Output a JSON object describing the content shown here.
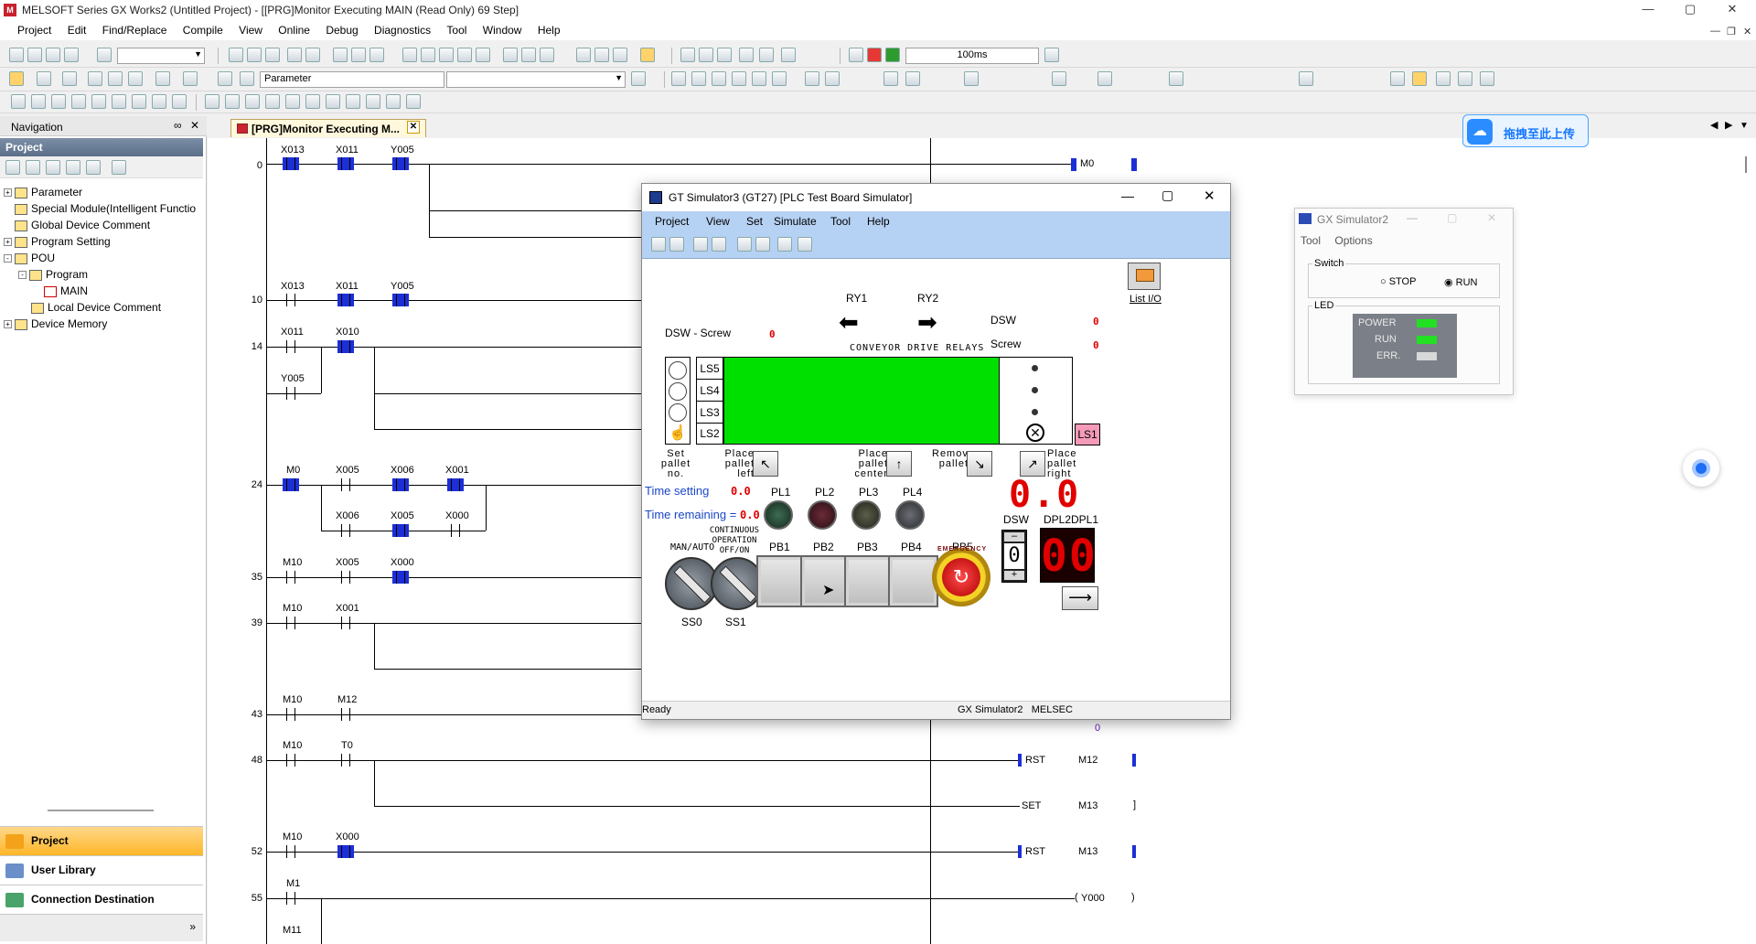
{
  "window": {
    "title": "MELSOFT Series GX Works2 (Untitled Project) - [[PRG]Monitor Executing MAIN (Read Only) 69 Step]",
    "icon_text": "M"
  },
  "menu": [
    "Project",
    "Edit",
    "Find/Replace",
    "Compile",
    "View",
    "Online",
    "Debug",
    "Diagnostics",
    "Tool",
    "Window",
    "Help"
  ],
  "toolbar": {
    "scan_combo": "100ms",
    "parameter_combo": "Parameter"
  },
  "navigation": {
    "title": "Navigation",
    "project_header": "Project",
    "tree": [
      {
        "label": "Parameter",
        "level": 0,
        "exp": "+"
      },
      {
        "label": "Special Module(Intelligent Functio",
        "level": 0,
        "exp": ""
      },
      {
        "label": "Global Device Comment",
        "level": 0,
        "exp": ""
      },
      {
        "label": "Program Setting",
        "level": 0,
        "exp": "+"
      },
      {
        "label": "POU",
        "level": 0,
        "exp": "-"
      },
      {
        "label": "Program",
        "level": 1,
        "exp": "-"
      },
      {
        "label": "MAIN",
        "level": 2,
        "exp": ""
      },
      {
        "label": "Local Device Comment",
        "level": 1,
        "exp": ""
      },
      {
        "label": "Device Memory",
        "level": 0,
        "exp": "+"
      }
    ],
    "bottom_buttons": [
      "Project",
      "User Library",
      "Connection Destination"
    ]
  },
  "editor_tab": {
    "label": "[PRG]Monitor Executing M..."
  },
  "ladder": {
    "steps": [
      "0",
      "10",
      "14",
      "24",
      "35",
      "39",
      "43",
      "48",
      "52",
      "55"
    ],
    "devices": {
      "r0": [
        "X013",
        "X011",
        "Y005"
      ],
      "r10": [
        "X013",
        "X011",
        "Y005"
      ],
      "r14": [
        "X011",
        "X010",
        "Y005"
      ],
      "r24": [
        "M0",
        "X005",
        "X006",
        "X001",
        "X006",
        "X005",
        "X000"
      ],
      "r35": [
        "M10",
        "X005",
        "X000"
      ],
      "r39": [
        "M10",
        "X001"
      ],
      "r43": [
        "M10",
        "M12"
      ],
      "r48": [
        "M10",
        "T0"
      ],
      "r52": [
        "M10",
        "X000"
      ],
      "r55": [
        "M1"
      ],
      "r_last": "M11"
    },
    "coils": {
      "m0": "M0",
      "rst1_cmd": "RST",
      "rst1_dev": "M12",
      "set_cmd": "SET",
      "set_dev": "M13",
      "rst2_cmd": "RST",
      "rst2_dev": "M13",
      "y000": "Y000",
      "timer_value": "0"
    }
  },
  "gt_simulator": {
    "title": "GT Simulator3 (GT27)  [PLC Test Board Simulator]",
    "menu": [
      "Project",
      "View",
      "Set",
      "Simulate",
      "Tool",
      "Help"
    ],
    "ry1": "RY1",
    "ry2": "RY2",
    "conveyor_label": "CONVEYOR DRIVE RELAYS",
    "list_io": "List I/O",
    "dsw_screw_label": "DSW - Screw",
    "dsw_screw_value": "0",
    "dsw_label": "DSW",
    "dsw_value": "0",
    "screw_label": "Screw",
    "screw_value": "0",
    "limit_switches": [
      "LS5",
      "LS4",
      "LS3",
      "LS2"
    ],
    "ls1": "LS1",
    "set_pallet": "Set\npallet\nno.",
    "place_left": "Place\npallet\nleft",
    "place_center": "Place\npallet\ncenter",
    "remove_pallet": "Remove\npallet",
    "place_right": "Place\npallet\nright",
    "time_setting_label": "Time setting",
    "time_setting_value": "0.0",
    "time_remaining_label": "Time remaining =",
    "time_remaining_value": "0.0",
    "pilot_lamps": [
      "PL1",
      "PL2",
      "PL3",
      "PL4"
    ],
    "seg_display": "0.0",
    "dsw_digit_label": "DSW",
    "dpl2": "DPL2",
    "dpl1": "DPL1",
    "dsw_digit": "0",
    "dpl_digits": "00",
    "man_auto": "MAN/AUTO",
    "continuous": "CONTINUOUS\nOPERATION\nOFF/ON",
    "push_buttons": [
      "PB1",
      "PB2",
      "PB3",
      "PB4"
    ],
    "pb5": "PB5",
    "ss0": "SS0",
    "ss1": "SS1",
    "emergency": "EMERGENCY",
    "status_left": "Ready",
    "status_right": "GX Simulator2   MELSEC",
    "colors": {
      "conveyor": "#00e000",
      "ls1": "#f59ab9",
      "led": "#e00000"
    }
  },
  "gx_simulator": {
    "title": "GX Simulator2",
    "menu": [
      "Tool",
      "Options"
    ],
    "switch_label": "Switch",
    "stop": "STOP",
    "run": "RUN",
    "led_label": "LED",
    "leds": [
      {
        "name": "POWER",
        "color": "#22e022"
      },
      {
        "name": "RUN",
        "color": "#22e022"
      },
      {
        "name": "ERR.",
        "color": "#d8d8d8"
      }
    ]
  },
  "upload_button": {
    "label": "拖拽至此上传"
  }
}
